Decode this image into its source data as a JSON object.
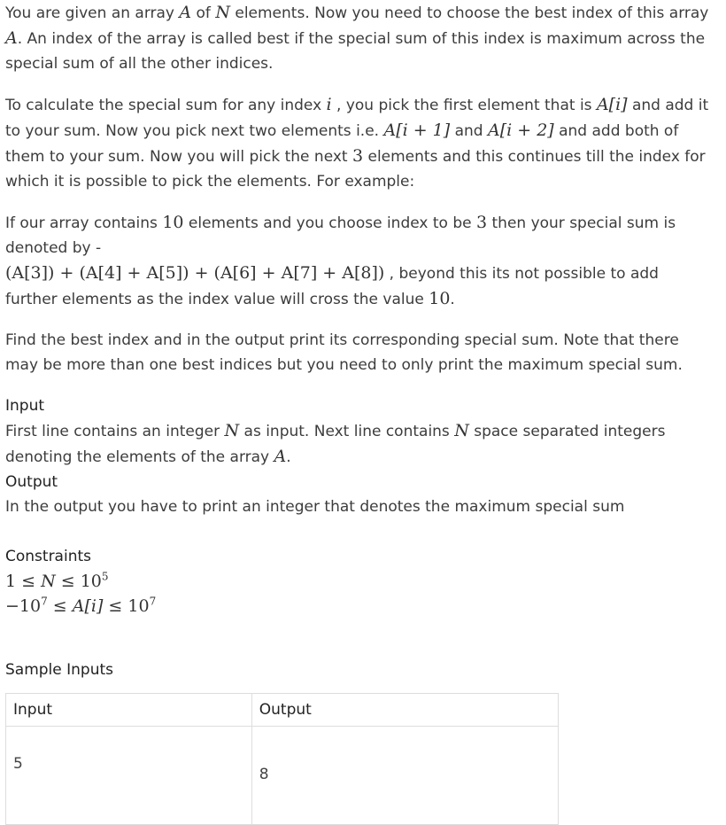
{
  "intro": {
    "p1_a": "You are given an array ",
    "p1_A": "A",
    "p1_b": " of ",
    "p1_N": "N",
    "p1_c": " elements. Now you need to choose the best index of this array ",
    "p1_A2": "A",
    "p1_d": ". An index of the array is called best if the special sum of this index is maximum across the special sum of all the other indices."
  },
  "calc": {
    "a": "To calculate the special sum for any index ",
    "i": "i",
    "b": " , you pick the first element that is ",
    "Ai": "A[i]",
    "c": " and add it to your sum. Now you pick next two elements i.e. ",
    "Ai1": "A[i + 1]",
    "d": " and ",
    "Ai2": "A[i + 2]",
    "e": " and add both of them to your sum. Now you will pick the next ",
    "three": "3",
    "f": " elements and this continues till the index for which it is possible to pick the elements. For example:"
  },
  "example": {
    "a": "If our array contains ",
    "ten": "10",
    "b": " elements and you choose index to be ",
    "three": "3",
    "c": " then your special sum is denoted by -",
    "formula": "(A[3]) + (A[4] + A[5]) + (A[6] + A[7] + A[8])",
    "d": " , beyond this its not possible to add further elements as the index value will cross the value ",
    "ten2": "10",
    "e": "."
  },
  "task": "Find the best index and in the output print its corresponding special sum. Note that there may be more than one best indices but you need to only print the maximum special sum.",
  "input_section": {
    "heading": "Input",
    "a": "First line contains an integer ",
    "N": "N",
    "b": " as input. Next line contains ",
    "N2": "N",
    "c": " space separated integers denoting the elements of the array ",
    "A": "A",
    "d": "."
  },
  "output_section": {
    "heading": "Output",
    "text": "In the output you have to print an integer that denotes the maximum special sum"
  },
  "constraints": {
    "heading": "Constraints",
    "line1_a": "1 ≤ ",
    "line1_N": "N",
    "line1_b": " ≤ 10",
    "line1_exp": "5",
    "line2_a": "−10",
    "line2_exp1": "7",
    "line2_b": " ≤ ",
    "line2_Ai": "A[i]",
    "line2_c": " ≤ 10",
    "line2_exp2": "7"
  },
  "samples": {
    "title": "Sample Inputs",
    "headers": [
      "Input",
      "Output"
    ],
    "rows": [
      {
        "input": "5",
        "output": "8"
      }
    ]
  }
}
